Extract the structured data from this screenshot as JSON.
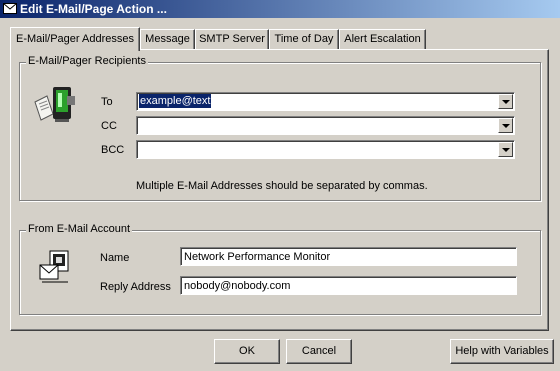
{
  "window": {
    "title": "Edit E-Mail/Page Action ...",
    "title_icon": "envelope-icon"
  },
  "tabs": [
    {
      "label": "E-Mail/Pager Addresses",
      "active": true
    },
    {
      "label": "Message",
      "active": false
    },
    {
      "label": "SMTP Server",
      "active": false
    },
    {
      "label": "Time of Day",
      "active": false
    },
    {
      "label": "Alert Escalation",
      "active": false
    }
  ],
  "recipients": {
    "group_label": "E-Mail/Pager Recipients",
    "icon": "pager-icon",
    "to_label": "To",
    "to_value": "example@text",
    "cc_label": "CC",
    "cc_value": "",
    "bcc_label": "BCC",
    "bcc_value": "",
    "hint": "Multiple E-Mail Addresses should be separated by commas."
  },
  "account": {
    "group_label": "From E-Mail Account",
    "icon": "mail-account-icon",
    "name_label": "Name",
    "name_value": "Network Performance Monitor",
    "reply_label": "Reply Address",
    "reply_value": "nobody@nobody.com"
  },
  "buttons": {
    "ok": "OK",
    "cancel": "Cancel",
    "help": "Help with Variables"
  },
  "colors": {
    "face": "#d4d0c8",
    "title_start": "#0a246a",
    "title_end": "#a6caf0",
    "selection": "#0a246a"
  }
}
